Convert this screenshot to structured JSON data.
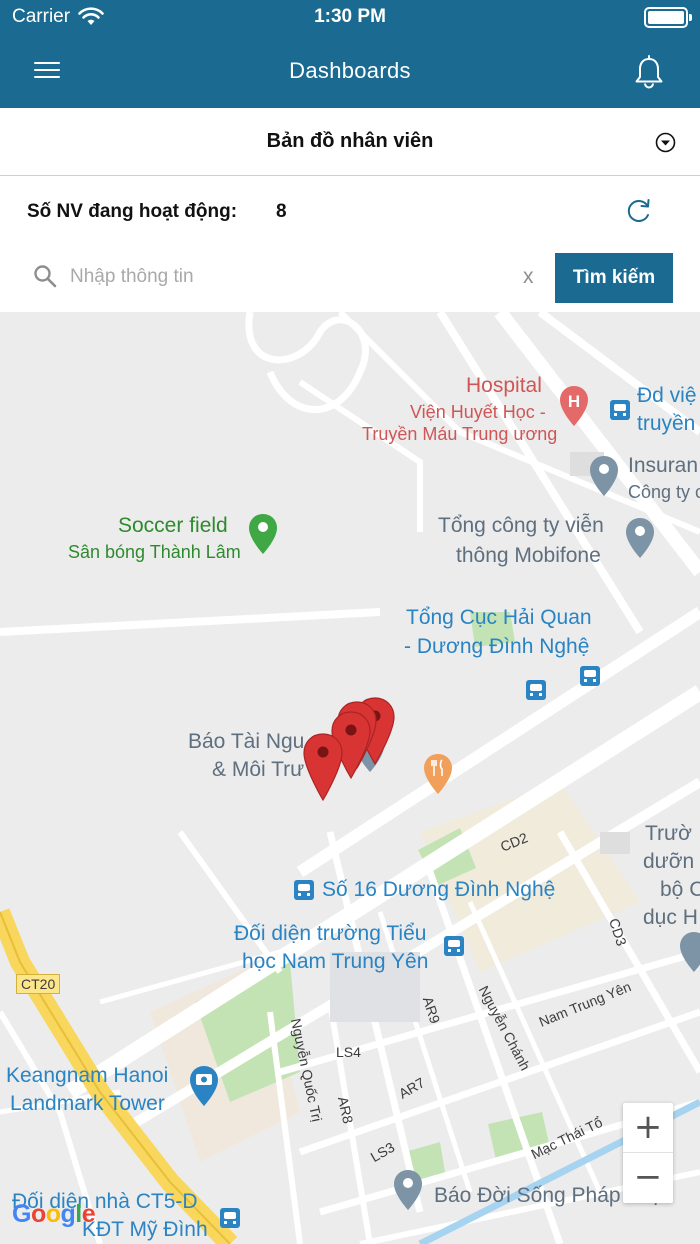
{
  "status_bar": {
    "carrier": "Carrier",
    "time": "1:30 PM"
  },
  "nav": {
    "title": "Dashboards",
    "menu_icon": "hamburger-menu-icon",
    "bell_icon": "bell-icon"
  },
  "selector": {
    "label": "Bản đồ nhân viên",
    "caret_icon": "chevron-down-circle-icon"
  },
  "active": {
    "label": "Số NV đang hoạt động:",
    "count": "8",
    "refresh_icon": "refresh-icon"
  },
  "search": {
    "placeholder": "Nhập thông tin",
    "clear_label": "x",
    "button_label": "Tìm kiếm",
    "icon": "search-icon"
  },
  "map": {
    "labels": {
      "hospital_title": "Hospital",
      "hospital_line1": "Viện Huyết Học -",
      "hospital_line2": "Truyền Máu Trung ương",
      "dd_vien_line1": "Đd việ",
      "dd_vien_line2": "truyền",
      "insurance_line1": "Insuran",
      "insurance_line2": "Công ty c",
      "soccer_title": "Soccer field",
      "soccer_sub": "Sân bóng Thành Lâm",
      "mobifone_line1": "Tổng công ty viễn",
      "mobifone_line2": "thông Mobifone",
      "haiquan_line1": "Tổng Cục Hải Quan",
      "haiquan_line2": "- Dương Đình Nghệ",
      "baotn_line1": "Báo Tài Ngu",
      "baotn_line2": "& Môi Trư",
      "cd2": "CD2",
      "cd3": "CD3",
      "truong_line1": "Trườ",
      "truong_line2": "dưỡn",
      "truong_line3": "bộ C",
      "truong_line4": "dục H",
      "so16": "Số 16 Dương Đình Nghệ",
      "doidien_line1": "Đối diện trường Tiểu",
      "doidien_line2": "học Nam Trung Yên",
      "ct20": "CT20",
      "ar9": "AR9",
      "nguyenchanh": "Nguyễn Chánh",
      "namtrungyen": "Nam Trung Yên",
      "nguyenquoctri": "Nguyễn Quốc Trị",
      "ls4": "LS4",
      "ar7": "AR7",
      "ar8": "AR8",
      "ls3": "LS3",
      "machaito": "Mạc Thái Tổ",
      "keangnam_line1": "Keangnam Hanoi",
      "keangnam_line2": "Landmark Tower",
      "baodoisong": "Báo Đời Sống Pháp Luật",
      "ct5_line1": "Đối diện nhà CT5-D",
      "ct5_line2": "KĐT Mỹ Đình"
    },
    "zoom_in": "+",
    "zoom_out": "−",
    "google": [
      "G",
      "o",
      "o",
      "g",
      "l",
      "e"
    ],
    "marker_color": "#d93434",
    "accent": "#1b6a91"
  }
}
